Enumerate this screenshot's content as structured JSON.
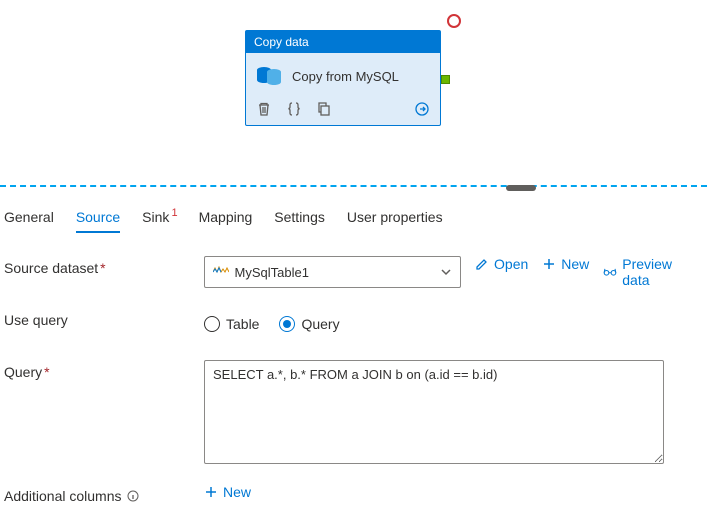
{
  "activity": {
    "header": "Copy data",
    "title": "Copy from MySQL"
  },
  "tabs": {
    "general": "General",
    "source": "Source",
    "sink": "Sink",
    "mapping": "Mapping",
    "settings": "Settings",
    "user_properties": "User properties"
  },
  "labels": {
    "source_dataset": "Source dataset",
    "use_query": "Use query",
    "query": "Query",
    "additional_columns": "Additional columns"
  },
  "dataset": {
    "selected": "MySqlTable1"
  },
  "actions": {
    "open": "Open",
    "new": "New",
    "preview": "Preview data"
  },
  "use_query_options": {
    "table": "Table",
    "query": "Query"
  },
  "query_value": "SELECT a.*, b.* FROM a JOIN b on (a.id == b.id)",
  "add_column": "New"
}
